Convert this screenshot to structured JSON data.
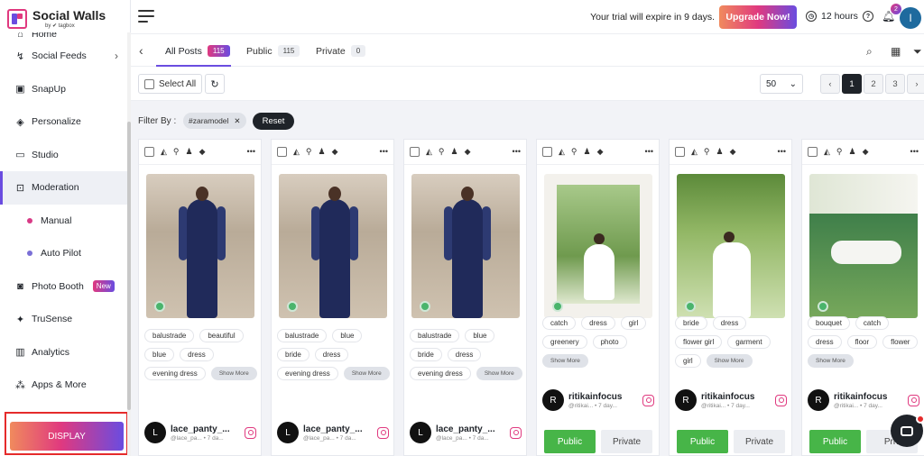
{
  "brand": {
    "title": "Social Walls",
    "subtitle": "by ✔ tagbox"
  },
  "sidebar": {
    "items": [
      {
        "label": "Home"
      },
      {
        "label": "Social Feeds"
      },
      {
        "label": "SnapUp"
      },
      {
        "label": "Personalize"
      },
      {
        "label": "Studio"
      },
      {
        "label": "Moderation"
      },
      {
        "label": "Manual"
      },
      {
        "label": "Auto Pilot"
      },
      {
        "label": "Photo Booth",
        "badge": "New"
      },
      {
        "label": "TruSense"
      },
      {
        "label": "Analytics"
      },
      {
        "label": "Apps & More"
      }
    ],
    "display_label": "DISPLAY"
  },
  "header": {
    "trial_text": "Your trial will expire in 9 days.",
    "upgrade_label": "Upgrade Now!",
    "timer": "12 hours",
    "notifications": "2",
    "avatar_initial": "I"
  },
  "tabs": [
    {
      "label": "All Posts",
      "count": "115"
    },
    {
      "label": "Public",
      "count": "115"
    },
    {
      "label": "Private",
      "count": "0"
    }
  ],
  "actions": {
    "select_all": "Select All",
    "per_page": "50",
    "pages": [
      "1",
      "2",
      "3"
    ],
    "prev": "‹",
    "next": "›"
  },
  "filter": {
    "label": "Filter By :",
    "chip": "#zaramodel",
    "reset": "Reset"
  },
  "cards": [
    {
      "tags": [
        "balustrade",
        "beautiful",
        "blue",
        "dress",
        "evening dress"
      ],
      "more": "Show More",
      "avatar": "L",
      "name": "lace_panty_...",
      "meta": "@lace_pa... • 7 da..."
    },
    {
      "tags": [
        "balustrade",
        "blue",
        "bride",
        "dress",
        "evening dress"
      ],
      "more": "Show More",
      "avatar": "L",
      "name": "lace_panty_...",
      "meta": "@lace_pa... • 7 da..."
    },
    {
      "tags": [
        "balustrade",
        "blue",
        "bride",
        "dress",
        "evening dress"
      ],
      "more": "Show More",
      "avatar": "L",
      "name": "lace_panty_...",
      "meta": "@lace_pa... • 7 da..."
    },
    {
      "tags": [
        "catch",
        "dress",
        "girl",
        "greenery",
        "photo"
      ],
      "more": "Show More",
      "avatar": "R",
      "name": "ritikainfocus",
      "meta": "@ritikai... • 7 day...",
      "public": "Public",
      "private": "Private"
    },
    {
      "tags": [
        "bride",
        "dress",
        "flower girl",
        "garment",
        "girl"
      ],
      "more": "Show More",
      "avatar": "R",
      "name": "ritikainfocus",
      "meta": "@ritikai... • 7 day...",
      "public": "Public",
      "private": "Private"
    },
    {
      "tags": [
        "bouquet",
        "catch",
        "dress",
        "floor",
        "flower"
      ],
      "more": "Show More",
      "avatar": "R",
      "name": "ritikainfocus",
      "meta": "@ritikai... • 7 day...",
      "public": "Public",
      "private": "Priv"
    }
  ]
}
